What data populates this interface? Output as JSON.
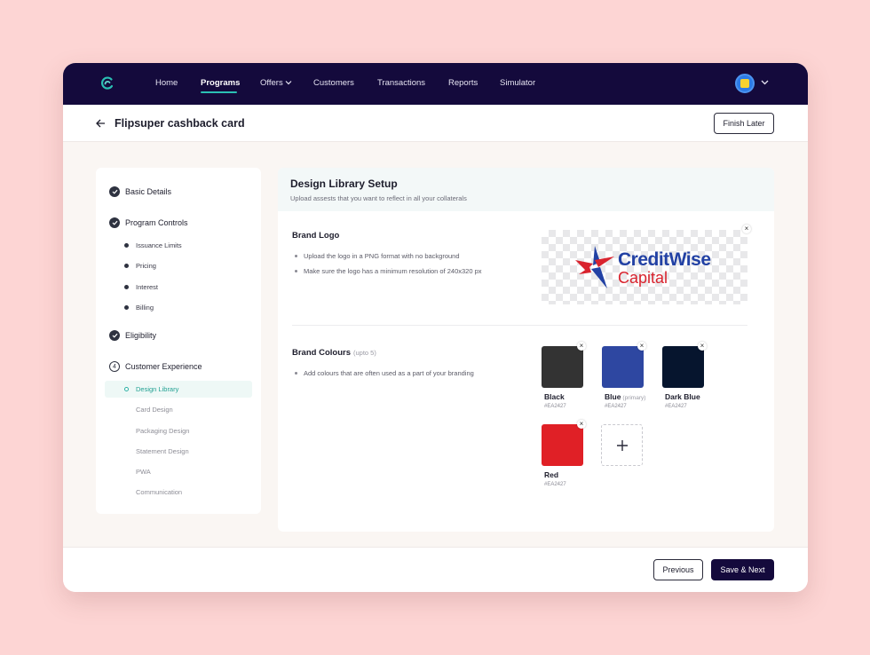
{
  "nav": {
    "items": [
      {
        "label": "Home"
      },
      {
        "label": "Programs"
      },
      {
        "label": "Offers"
      },
      {
        "label": "Customers"
      },
      {
        "label": "Transactions"
      },
      {
        "label": "Reports"
      },
      {
        "label": "Simulator"
      }
    ],
    "active": "Programs",
    "logo_icon": "swirl-logo-icon",
    "avatar_icon": "flipkart-avatar-icon"
  },
  "header": {
    "title": "Flipsuper cashback card",
    "finish_later_label": "Finish Later"
  },
  "sidebar": {
    "steps": [
      {
        "label": "Basic Details",
        "status": "done"
      },
      {
        "label": "Program Controls",
        "status": "done",
        "substeps": [
          "Issuance Limits",
          "Pricing",
          "Interest",
          "Billing"
        ]
      },
      {
        "label": "Eligibility",
        "status": "done"
      },
      {
        "label": "Customer Experience",
        "status": "current",
        "number": "4",
        "substeps": [
          "Design Library",
          "Card Design",
          "Packaging Design",
          "Statement Design",
          "PWA",
          "Communication"
        ],
        "active_substep": "Design Library"
      }
    ]
  },
  "panel": {
    "title": "Design Library Setup",
    "subtitle": "Upload assests that you want to reflect in all your collaterals",
    "brand_logo": {
      "title": "Brand Logo",
      "bullets": [
        "Upload the logo in a PNG format with no background",
        "Make sure the logo has a minimum resolution of 240x320 px"
      ],
      "logo_text_1": "CreditWise",
      "logo_text_2": "Capital"
    },
    "brand_colours": {
      "title": "Brand Colours",
      "hint": "(upto 5)",
      "bullets": [
        "Add colours that are often used as a part of your branding"
      ],
      "swatches": [
        {
          "name": "Black",
          "hint": "",
          "hex": "#EA2427",
          "color": "#333333"
        },
        {
          "name": "Blue",
          "hint": "(primary)",
          "hex": "#EA2427",
          "color": "#2e47a1"
        },
        {
          "name": "Dark Blue",
          "hint": "",
          "hex": "#EA2427",
          "color": "#06152e"
        },
        {
          "name": "Red",
          "hint": "",
          "hex": "#EA2427",
          "color": "#e02026"
        }
      ],
      "add_label": "+"
    }
  },
  "footer": {
    "previous_label": "Previous",
    "next_label": "Save & Next"
  },
  "colors": {
    "nav_bg": "#140a3c",
    "accent": "#2bc0b4",
    "page_bg": "#fdd5d4"
  }
}
